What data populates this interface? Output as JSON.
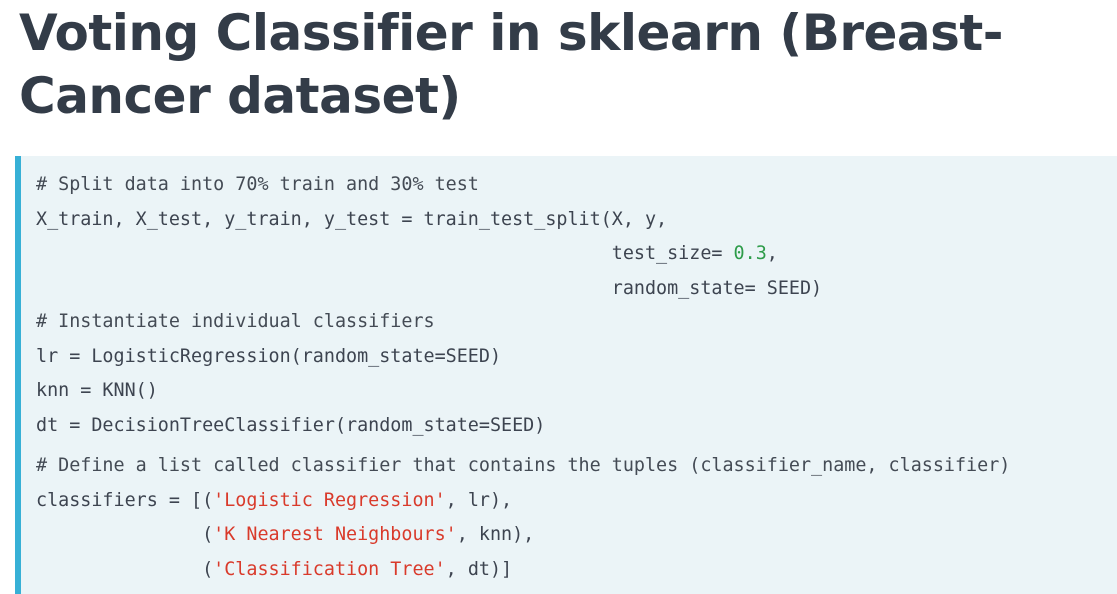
{
  "title": "Voting Classifier in sklearn (Breast-Cancer dataset)",
  "code": {
    "section1": {
      "comment": "# Split data into 70% train and 30% test",
      "line1": "X_train, X_test, y_train, y_test = train_test_split(X, y,",
      "line2_pre": "                                                    test_size= ",
      "line2_num": "0.3",
      "line2_post": ",",
      "line3": "                                                    random_state= SEED)"
    },
    "section2": {
      "comment": "# Instantiate individual classifiers",
      "line1": "lr = LogisticRegression(random_state=SEED)",
      "line2": "knn = KNN()",
      "line3": "dt = DecisionTreeClassifier(random_state=SEED)"
    },
    "section3": {
      "comment": "# Define a list called classifier that contains the tuples (classifier_name, classifier)",
      "line1_pre": "classifiers = [(",
      "line1_str": "'Logistic Regression'",
      "line1_post": ", lr),",
      "line2_pre": "               (",
      "line2_str": "'K Nearest Neighbours'",
      "line2_post": ", knn),",
      "line3_pre": "               (",
      "line3_str": "'Classification Tree'",
      "line3_post": ", dt)]"
    }
  },
  "colors": {
    "title": "#333c48",
    "code_background": "#ebf4f7",
    "code_border": "#37b0d6",
    "number": "#2e9c4a",
    "string": "#d93a2b"
  }
}
